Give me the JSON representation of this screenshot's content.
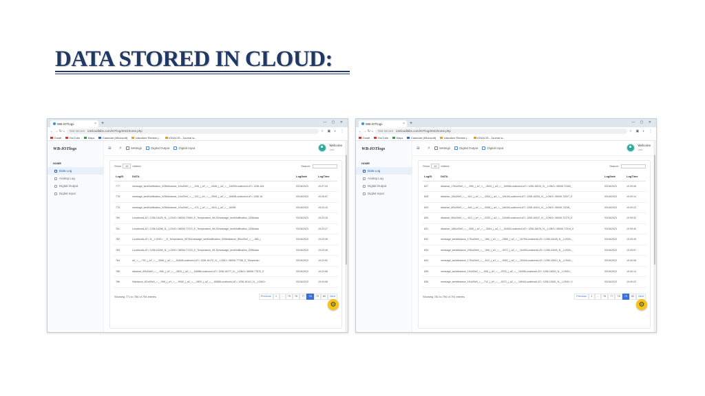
{
  "slide": {
    "title": "DATA STORED IN CLOUD:"
  },
  "screenshots": [
    {
      "browser": {
        "tab_title": "WB-IOTlogs",
        "new_tab": "+",
        "window_controls": "— ▢ ✕",
        "url_prefix": "Not secure",
        "url": "iotcloudlabs.com/IOTlog/2021home.php",
        "bookmarks": [
          "Gmail",
          "YouTube",
          "Maps",
          "Calendar (Microsoft)",
          "Literature Review (...",
          "IGNACIS - Journal w..."
        ]
      },
      "app": {
        "brand": "WB-IOTlogs",
        "menu_label": "HOME",
        "nav": [
          "Data Log",
          "Analog Log",
          "Digital Output",
          "Digital Input"
        ],
        "topnav": [
          "Settings",
          "Digital Output",
          "Digital Input"
        ],
        "user_name": "Welcome",
        "user_sub": "User",
        "show_label_pre": "Show",
        "show_value": "10",
        "show_label_post": "entries",
        "search_label": "Search:",
        "columns": [
          "LogID",
          "DATA",
          "LogDate",
          "LogTime"
        ],
        "rows": [
          [
            "777",
            "message_sentNotification_0256distance_10\\u00e0_=__-005_|_aY_=__-0646_|_aZ_=__16000Locations\\LAT= 1256.164",
            "03/16/2023",
            "19:27:03"
          ],
          [
            "778",
            "message_sentNotification_0256distance_11\\u00e0_=__-192_|_aY_=__-2508_|_aZ_=__16808Locations\\LAT= 1256.16",
            "03/16/2023",
            "19:26:57"
          ],
          [
            "779",
            "message_sentNotification_0256distance_10\\u00e0_=__-471_|_aY_=__-2611_|_aZ_=__16096",
            "03/16/2023",
            "19:23:10"
          ],
          [
            "780",
            "Locations\\LAT= 1256.16420_N__LONG= 08006.72669_E_Temperature_96.2Amessage_sentNotification_0256data",
            "03/16/2023",
            "19:23:18"
          ],
          [
            "781",
            "Locations\\LAT= 1256.16286_N__LONG= 08006.77072_E_Temperature_96.2Amessage_sentNotification_0256data",
            "03/16/2023",
            "19:23:27"
          ],
          [
            "782",
            "Locations\\LAT= N__LONG= __E_Temperature_0575Amessage_sentNotification_0256distance_85\\u00e0_=__-385_|",
            "03/16/2023",
            "19:23:36"
          ],
          [
            "783",
            "Locations\\LAT= 1256.16260_N__LONG= 08006.77223_E_Temperature_95.3Amessage_sentNotification_0256data",
            "03/16/2023",
            "19:23:46"
          ],
          [
            "784",
            "aX_=__-792_|_aY_=__-2656_|_aZ_=__16448Locations\\LAT= 1256.16170_N__LONG= 08006.77766_E_Temperatu",
            "03/16/2023",
            "19:23:52"
          ],
          [
            "785",
            "distance_83\\u00e0_=__-996_|_aY_=__-2820_|_aZ_=__16588Locations\\LAT= 1256.16277_N__LONG= 08006.77870_E",
            "03/16/2023",
            "19:23:58"
          ],
          [
            "786",
            "Sdistance_82\\u00e0_=__-998_|_aY_=__-9536_|_aZ_=__-2820_|_aZ_=__16588Locations\\LAT= 1256.16141_N__LONG=",
            "03/16/2023",
            "19:24:06"
          ]
        ],
        "showing": "Showing 771 to 780 of 794 entries",
        "pager": [
          "Previous",
          "1",
          "...",
          "75",
          "76",
          "77",
          "78",
          "79",
          "80",
          "Next"
        ],
        "active_page": "78"
      }
    },
    {
      "browser": {
        "tab_title": "WB-IOTlogs",
        "new_tab": "+",
        "window_controls": "— ▢ ✕",
        "url_prefix": "Not secure",
        "url": "iotcloudlabs.com/IOTlog/2021home.php",
        "bookmarks": [
          "Gmail",
          "YouTube",
          "Maps",
          "Calendar (Microsoft)",
          "Literature Review (...",
          "IGNACIS - Journal w..."
        ]
      },
      "app": {
        "brand": "WB-IOTlogs",
        "menu_label": "HOME",
        "nav": [
          "Data Log",
          "Analog Log",
          "Digital Output",
          "Digital Input"
        ],
        "topnav": [
          "Settings",
          "Digital Output",
          "Digital Input"
        ],
        "user_name": "Welcome",
        "user_sub": "User",
        "show_label_pre": "Show",
        "show_value": "10",
        "show_label_post": "entries",
        "search_label": "Search:",
        "columns": [
          "LogID",
          "DATA",
          "LogDate",
          "LogTime"
        ],
        "rows": [
          [
            "827",
            "distance_176\\u00e0_=__-595_|_aY_=__-3520_|_aZ_=__16556Locations\\LAT= 1256.16514_N__LONG= 08006.72462_",
            "03/16/2023",
            "19:39:06"
          ],
          [
            "828",
            "distance_15\\u00e0_=__-910_|_aY_=__-2904_|_aZ_=__16416Locations\\LAT= 1256.16254_N__LONG= 08006.72027_E",
            "03/16/2023",
            "19:39:14"
          ],
          [
            "829",
            "distance_80\\u00e0_=__-644_|_aY_=__-3068_|_aZ_=__16616Locations\\LAT= 1256.16341_N__LONG= 08006.72038_",
            "03/16/2023",
            "19:39:22"
          ],
          [
            "830",
            "distance_96\\u00e0_=__-612_|_aY_=__-3292_|_aZ_=__15448Locations\\LAT= 1256.16347_N__LONG= 08006.72173_E",
            "03/16/2023",
            "19:39:32"
          ],
          [
            "831",
            "distance_186\\u00e0_=__-608_|_aY_=__-3064_|_aZ_=__16452Locations\\LAT= 1256.16576_N__LONG= 08006.72314_E",
            "03/16/2023",
            "19:39:40"
          ],
          [
            "832",
            "message_sentdistance_176\\u00e0_=__-660_|_aY_=__-2968_|_aZ_=__16700Locations\\LAT= 1256.16248_N__LONG=_",
            "03/16/2023",
            "19:39:49"
          ],
          [
            "833",
            "message_sentdistance_206\\u00e0_=__-596_|_aY_=__-3072_|_aZ_=__16400Locations\\LAT= 1256.15494_N__LONG=_",
            "03/16/2023",
            "19:39:57"
          ],
          [
            "834",
            "message_sentdistance_176\\u00e0_=__-612_|_aY_=__-3052_|_aZ_=__16344Locations\\LAT= 1256.15510_N__LONG=_",
            "03/16/2023",
            "19:40:06"
          ],
          [
            "835",
            "message_sentdistance_16\\u00e0_=__-508_|_aY_=__-2976_|_aZ_=__16496Locations\\LAT= 1256.16002_N__LONG=_",
            "03/16/2023",
            "19:40:14"
          ],
          [
            "836",
            "message_sentdistance_16\\u00e0_=__-712_|_aY_=__-3072_|_aZ_=__16544Locations\\LAT= 1256.15481_N__LONG= 0",
            "03/16/2023",
            "19:40:22"
          ]
        ],
        "showing": "Showing 781 to 790 of 791 entries",
        "pager": [
          "Previous",
          "1",
          "...",
          "76",
          "77",
          "78",
          "79",
          "80",
          "Next"
        ],
        "active_page": "79"
      }
    }
  ],
  "colors": {
    "title": "#1f3864",
    "accent": "#3a6fd8",
    "fab": "#f5c518",
    "avatar": "#2fa89f"
  },
  "icons": {
    "fab": "gear-icon",
    "nav": "list-icon",
    "topnav": "settings-icon"
  }
}
